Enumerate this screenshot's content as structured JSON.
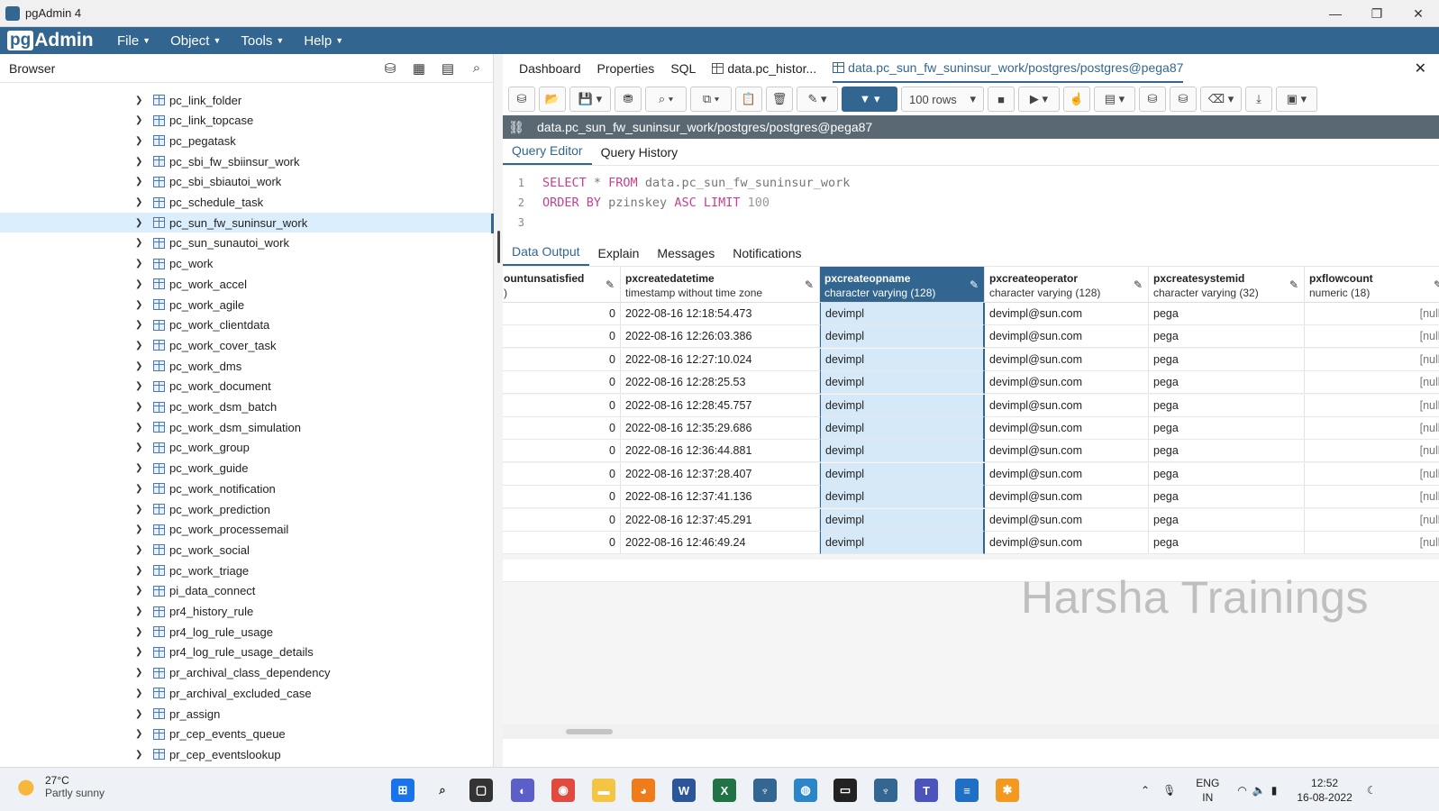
{
  "window": {
    "title": "pgAdmin 4",
    "controls": [
      "—",
      "❐",
      "✕"
    ]
  },
  "menubar": {
    "logo_pg": "pg",
    "logo_rest": "Admin",
    "items": [
      "File",
      "Object",
      "Tools",
      "Help"
    ]
  },
  "browser": {
    "title": "Browser",
    "tree": [
      "pc_link_folder",
      "pc_link_topcase",
      "pc_pegatask",
      "pc_sbi_fw_sbiinsur_work",
      "pc_sbi_sbiautoi_work",
      "pc_schedule_task",
      "pc_sun_fw_suninsur_work",
      "pc_sun_sunautoi_work",
      "pc_work",
      "pc_work_accel",
      "pc_work_agile",
      "pc_work_clientdata",
      "pc_work_cover_task",
      "pc_work_dms",
      "pc_work_document",
      "pc_work_dsm_batch",
      "pc_work_dsm_simulation",
      "pc_work_group",
      "pc_work_guide",
      "pc_work_notification",
      "pc_work_prediction",
      "pc_work_processemail",
      "pc_work_social",
      "pc_work_triage",
      "pi_data_connect",
      "pr4_history_rule",
      "pr4_log_rule_usage",
      "pr4_log_rule_usage_details",
      "pr_archival_class_dependency",
      "pr_archival_excluded_case",
      "pr_assign",
      "pr_cep_events_queue",
      "pr_cep_eventslookup"
    ],
    "selected_index": 6
  },
  "tabs": [
    "Dashboard",
    "Properties",
    "SQL",
    "data.pc_histor...",
    "data.pc_sun_fw_suninsur_work/postgres/postgres@pega87"
  ],
  "toolbar": {
    "rows_limit": "100 rows"
  },
  "connection": "data.pc_sun_fw_suninsur_work/postgres/postgres@pega87",
  "query_tabs": [
    "Query Editor",
    "Query History"
  ],
  "editor": {
    "lines": [
      {
        "n": "1",
        "kw1": "SELECT",
        "mid": " * ",
        "kw2": "FROM",
        "rest": " data.pc_sun_fw_suninsur_work"
      },
      {
        "n": "2",
        "kw1": "ORDER BY",
        "mid": " pzinskey ",
        "kw2": "ASC LIMIT",
        "rest": " 100"
      },
      {
        "n": "3",
        "kw1": "",
        "mid": "",
        "kw2": "",
        "rest": ""
      }
    ]
  },
  "output_tabs": [
    "Data Output",
    "Explain",
    "Messages",
    "Notifications"
  ],
  "grid": {
    "columns": [
      {
        "name": "ountunsatisfied",
        "type": ")"
      },
      {
        "name": "pxcreatedatetime",
        "type": "timestamp without time zone"
      },
      {
        "name": "pxcreateopname",
        "type": "character varying (128)"
      },
      {
        "name": "pxcreateoperator",
        "type": "character varying (128)"
      },
      {
        "name": "pxcreatesystemid",
        "type": "character varying (32)"
      },
      {
        "name": "pxflowcount",
        "type": "numeric (18)"
      }
    ],
    "selected_column": 2,
    "rows": [
      [
        "0",
        "2022-08-16 12:18:54.473",
        "devimpl",
        "devimpl@sun.com",
        "pega",
        "[null]"
      ],
      [
        "0",
        "2022-08-16 12:26:03.386",
        "devimpl",
        "devimpl@sun.com",
        "pega",
        "[null]"
      ],
      [
        "0",
        "2022-08-16 12:27:10.024",
        "devimpl",
        "devimpl@sun.com",
        "pega",
        "[null]"
      ],
      [
        "0",
        "2022-08-16 12:28:25.53",
        "devimpl",
        "devimpl@sun.com",
        "pega",
        "[null]"
      ],
      [
        "0",
        "2022-08-16 12:28:45.757",
        "devimpl",
        "devimpl@sun.com",
        "pega",
        "[null]"
      ],
      [
        "0",
        "2022-08-16 12:35:29.686",
        "devimpl",
        "devimpl@sun.com",
        "pega",
        "[null]"
      ],
      [
        "0",
        "2022-08-16 12:36:44.881",
        "devimpl",
        "devimpl@sun.com",
        "pega",
        "[null]"
      ],
      [
        "0",
        "2022-08-16 12:37:28.407",
        "devimpl",
        "devimpl@sun.com",
        "pega",
        "[null]"
      ],
      [
        "0",
        "2022-08-16 12:37:41.136",
        "devimpl",
        "devimpl@sun.com",
        "pega",
        "[null]"
      ],
      [
        "0",
        "2022-08-16 12:37:45.291",
        "devimpl",
        "devimpl@sun.com",
        "pega",
        "[null]"
      ],
      [
        "0",
        "2022-08-16 12:46:49.24",
        "devimpl",
        "devimpl@sun.com",
        "pega",
        "[null]"
      ]
    ]
  },
  "watermark": "Harsha Trainings",
  "taskbar": {
    "weather_temp": "27°C",
    "weather_desc": "Partly sunny",
    "lang_top": "ENG",
    "lang_bottom": "IN",
    "time": "12:52",
    "date": "16-08-2022"
  },
  "colors": {
    "brand": "#326690",
    "selection": "#d5e9f8",
    "connbar": "#5a6873"
  }
}
